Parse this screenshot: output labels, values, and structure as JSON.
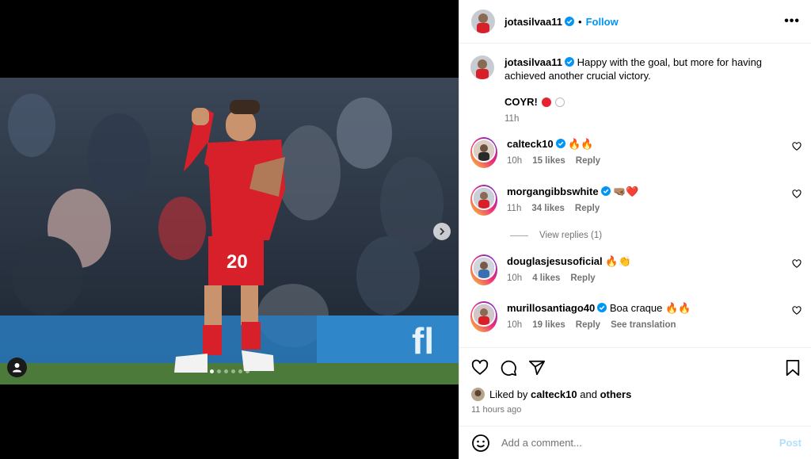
{
  "post": {
    "author": "jotasilvaa11",
    "follow_label": "Follow",
    "more_label": "•••",
    "separator": "•",
    "caption": "Happy with the goal, but more for having achieved another crucial victory.",
    "caption_tag": "COYR!",
    "caption_time": "11h",
    "shirt_number": "20"
  },
  "comments": [
    {
      "user": "calteck10",
      "text": "🔥🔥",
      "time": "10h",
      "likes": "15 likes",
      "reply": "Reply",
      "verified": true
    },
    {
      "user": "morgangibbswhite",
      "text": "🤜🏽❤️",
      "time": "11h",
      "likes": "34 likes",
      "reply": "Reply",
      "verified": true
    },
    {
      "user": "douglasjesusoficial",
      "text": "🔥👏",
      "time": "10h",
      "likes": "4 likes",
      "reply": "Reply",
      "verified": false
    },
    {
      "user": "murillosantiago40",
      "text": "Boa craque 🔥🔥",
      "time": "10h",
      "likes": "19 likes",
      "reply": "Reply",
      "extra": "See translation",
      "verified": true
    }
  ],
  "view_replies": "View replies (1)",
  "likes_summary": {
    "prefix": "Liked by ",
    "user": "calteck10",
    "mid": " and ",
    "others": "others"
  },
  "post_age": "11 hours ago",
  "comment_input": {
    "placeholder": "Add a comment...",
    "post_label": "Post"
  },
  "carousel": {
    "count": 6,
    "active": 0
  },
  "colors": {
    "accent": "#0095f6",
    "kit_red": "#d8202a",
    "muted": "#737373"
  }
}
